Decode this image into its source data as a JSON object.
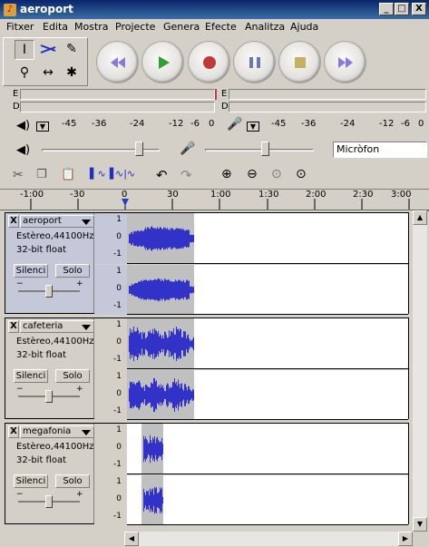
{
  "window": {
    "title": "aeroport",
    "min": "_",
    "max": "□",
    "close": "X"
  },
  "menu": [
    "Fitxer",
    "Edita",
    "Mostra",
    "Projecte",
    "Genera",
    "Efecte",
    "Analitza",
    "Ajuda"
  ],
  "meters": {
    "play_letters": [
      "E",
      "D"
    ],
    "rec_letters": [
      "E",
      "D"
    ],
    "play_scale": [
      "-45",
      "-36",
      "-24",
      "-12",
      "-6",
      "0"
    ],
    "rec_scale": [
      "-45",
      "-36",
      "-24",
      "-12",
      "-6",
      "0"
    ]
  },
  "mixer": {
    "input_source": "Micròfon",
    "playback_level": 0.82,
    "record_level": 0.55
  },
  "timeline": {
    "ticks": [
      "-1:00",
      "-30",
      "0",
      "30",
      "1:00",
      "1:30",
      "2:00",
      "2:30",
      "3:00"
    ]
  },
  "tracks": [
    {
      "name": "aeroport",
      "format": "Estèreo,44100Hz",
      "bits": "32-bit float",
      "mute": "Silenci",
      "solo": "Solo",
      "selected": true,
      "gain": 0.5
    },
    {
      "name": "cafeteria",
      "format": "Estèreo,44100Hz",
      "bits": "32-bit float",
      "mute": "Silenci",
      "solo": "Solo",
      "selected": false,
      "gain": 0.5
    },
    {
      "name": "megafonia",
      "format": "Estèreo,44100Hz",
      "bits": "32-bit float",
      "mute": "Silenci",
      "solo": "Solo",
      "selected": false,
      "gain": 0.5
    }
  ],
  "vscale": [
    "1",
    "0",
    "-1"
  ],
  "colors": {
    "waveform": "#3232c8",
    "selection": "#c0c0c0",
    "title_bar": "#0a246a"
  }
}
